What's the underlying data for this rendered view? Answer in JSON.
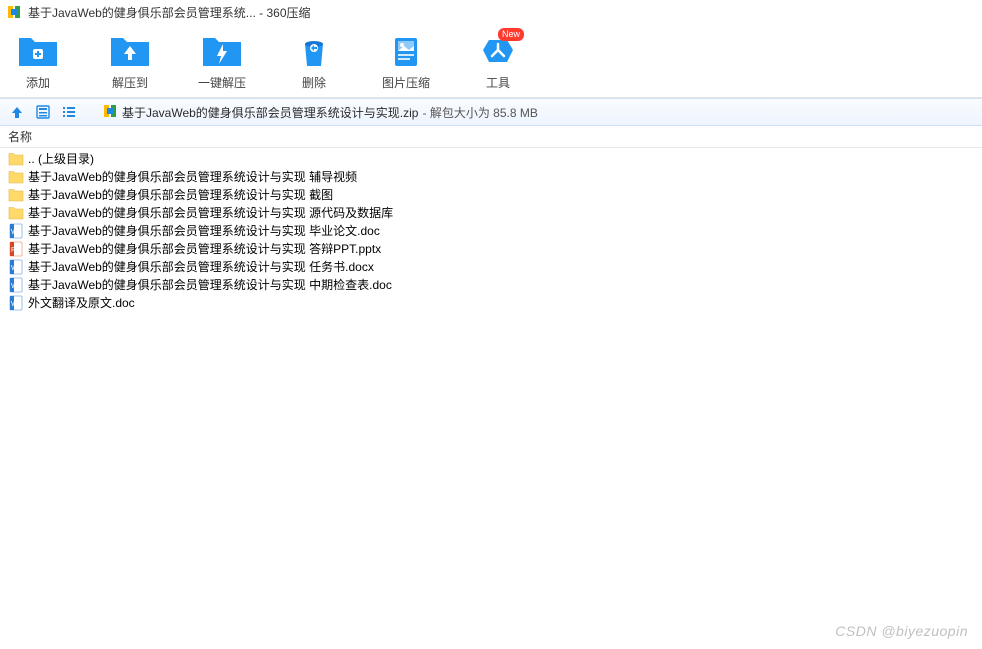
{
  "window": {
    "title": "基于JavaWeb的健身俱乐部会员管理系统...  - 360压缩"
  },
  "toolbar": {
    "add": "添加",
    "extract_to": "解压到",
    "one_click": "一键解压",
    "delete": "删除",
    "image_compress": "图片压缩",
    "tools": "工具",
    "new_badge": "New"
  },
  "path": {
    "archive_name": "基于JavaWeb的健身俱乐部会员管理系统设计与实现.zip",
    "size_text": " - 解包大小为 85.8 MB"
  },
  "columns": {
    "name": "名称"
  },
  "files": [
    {
      "icon": "folder-up",
      "name": ".. (上级目录)"
    },
    {
      "icon": "folder",
      "name": "基于JavaWeb的健身俱乐部会员管理系统设计与实现 辅导视频"
    },
    {
      "icon": "folder",
      "name": "基于JavaWeb的健身俱乐部会员管理系统设计与实现 截图"
    },
    {
      "icon": "folder",
      "name": "基于JavaWeb的健身俱乐部会员管理系统设计与实现 源代码及数据库"
    },
    {
      "icon": "doc",
      "name": "基于JavaWeb的健身俱乐部会员管理系统设计与实现 毕业论文.doc"
    },
    {
      "icon": "ppt",
      "name": "基于JavaWeb的健身俱乐部会员管理系统设计与实现 答辩PPT.pptx"
    },
    {
      "icon": "doc",
      "name": "基于JavaWeb的健身俱乐部会员管理系统设计与实现 任务书.docx"
    },
    {
      "icon": "doc",
      "name": "基于JavaWeb的健身俱乐部会员管理系统设计与实现 中期检查表.doc"
    },
    {
      "icon": "doc",
      "name": "外文翻译及原文.doc"
    }
  ],
  "watermark": "CSDN @biyezuopin"
}
